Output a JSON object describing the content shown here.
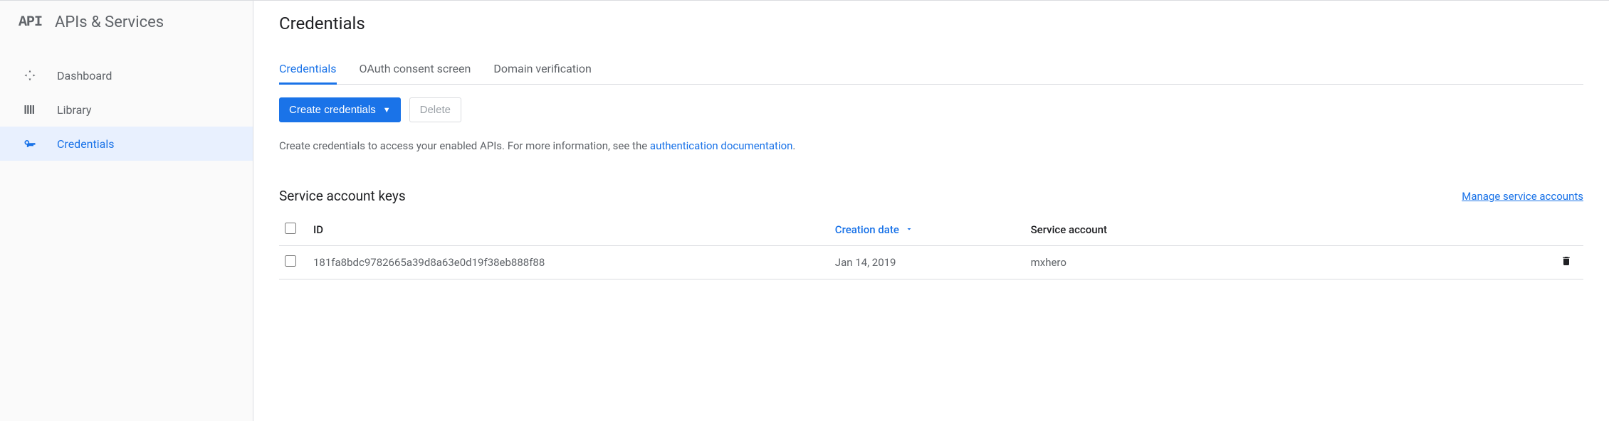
{
  "sidebar": {
    "logo_text": "API",
    "title": "APIs & Services",
    "items": [
      {
        "label": "Dashboard",
        "icon": "dashboard"
      },
      {
        "label": "Library",
        "icon": "library"
      },
      {
        "label": "Credentials",
        "icon": "key"
      }
    ]
  },
  "page": {
    "title": "Credentials"
  },
  "tabs": [
    {
      "label": "Credentials",
      "active": true
    },
    {
      "label": "OAuth consent screen",
      "active": false
    },
    {
      "label": "Domain verification",
      "active": false
    }
  ],
  "actions": {
    "create_label": "Create credentials",
    "delete_label": "Delete"
  },
  "info": {
    "text_before": "Create credentials to access your enabled APIs. For more information, see the ",
    "link_text": "authentication documentation",
    "text_after": "."
  },
  "section": {
    "title": "Service account keys",
    "manage_link": "Manage service accounts"
  },
  "table": {
    "columns": {
      "id": "ID",
      "creation_date": "Creation date",
      "service_account": "Service account"
    },
    "rows": [
      {
        "id": "181fa8bdc9782665a39d8a63e0d19f38eb888f88",
        "creation_date": "Jan 14, 2019",
        "service_account": "mxhero"
      }
    ]
  }
}
